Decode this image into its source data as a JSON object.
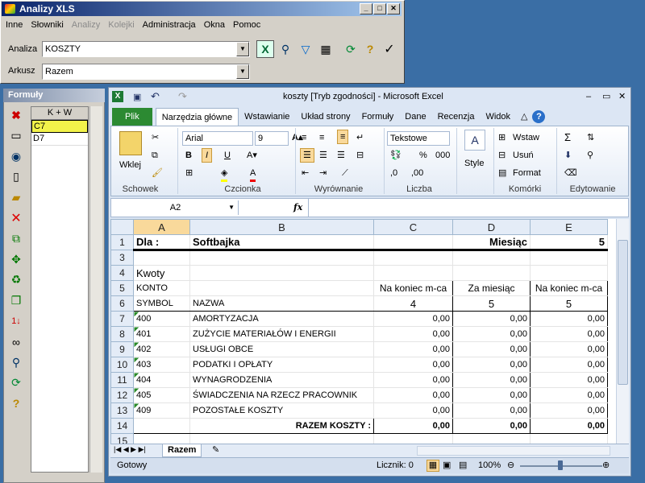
{
  "app": {
    "title": "Analizy XLS",
    "menu": [
      "Inne",
      "Słowniki",
      "Analizy",
      "Kolejki",
      "Administracja",
      "Okna",
      "Pomoc"
    ],
    "menu_disabled": [
      false,
      false,
      true,
      true,
      false,
      false,
      false
    ],
    "analiza_label": "Analiza",
    "analiza_value": "KOSZTY",
    "arkusz_label": "Arkusz",
    "arkusz_value": "Razem"
  },
  "formula_panel": {
    "title": "Formuły",
    "column_header": "K + W",
    "rows": [
      "C7",
      "D7"
    ]
  },
  "excel": {
    "title": "koszty  [Tryb zgodności]  -  Microsoft Excel",
    "tabs": [
      "Plik",
      "Narzędzia główne",
      "Wstawianie",
      "Układ strony",
      "Formuły",
      "Dane",
      "Recenzja",
      "Widok"
    ],
    "groups": {
      "schowek": "Schowek",
      "czcionka": "Czcionka",
      "wyrownanie": "Wyrównanie",
      "liczba": "Liczba",
      "komorki": "Komórki",
      "edytowanie": "Edytowanie"
    },
    "paste_label": "Wklej",
    "font_name": "Arial",
    "font_size": "9",
    "number_format": "Tekstowe",
    "style_label": "Style",
    "insert_label": "Wstaw",
    "delete_label": "Usuń",
    "format_label": "Format",
    "name_box": "A2",
    "fx": "fx",
    "columns": [
      "A",
      "B",
      "C",
      "D",
      "E"
    ],
    "rows": [
      {
        "n": "1",
        "a": "Dla :",
        "b": "Softbajka",
        "c": "",
        "d": "Miesiąc",
        "e": "5"
      },
      {
        "n": "3",
        "a": "",
        "b": "",
        "c": "",
        "d": "",
        "e": ""
      },
      {
        "n": "4",
        "a": "Kwoty",
        "b": "",
        "c": "",
        "d": "",
        "e": ""
      },
      {
        "n": "5",
        "a": "KONTO",
        "b": "",
        "c": "Na koniec m-ca",
        "d": "Za miesiąc",
        "e": "Na koniec m-ca"
      },
      {
        "n": "6",
        "a": "SYMBOL",
        "b": "NAZWA",
        "c": "4",
        "d": "5",
        "e": "5"
      },
      {
        "n": "7",
        "a": "400",
        "b": "AMORTYZACJA",
        "c": "0,00",
        "d": "0,00",
        "e": "0,00"
      },
      {
        "n": "8",
        "a": "401",
        "b": "ZUŻYCIE MATERIAŁÓW I ENERGII",
        "c": "0,00",
        "d": "0,00",
        "e": "0,00"
      },
      {
        "n": "9",
        "a": "402",
        "b": "USŁUGI OBCE",
        "c": "0,00",
        "d": "0,00",
        "e": "0,00"
      },
      {
        "n": "10",
        "a": "403",
        "b": "PODATKI I OPŁATY",
        "c": "0,00",
        "d": "0,00",
        "e": "0,00"
      },
      {
        "n": "11",
        "a": "404",
        "b": "WYNAGRODZENIA",
        "c": "0,00",
        "d": "0,00",
        "e": "0,00"
      },
      {
        "n": "12",
        "a": "405",
        "b": "ŚWIADCZENIA NA RZECZ PRACOWNIK",
        "c": "0,00",
        "d": "0,00",
        "e": "0,00"
      },
      {
        "n": "13",
        "a": "409",
        "b": "POZOSTAŁE KOSZTY",
        "c": "0,00",
        "d": "0,00",
        "e": "0,00"
      },
      {
        "n": "14",
        "a": "",
        "b": "RAZEM KOSZTY :",
        "c": "0,00",
        "d": "0,00",
        "e": "0,00"
      },
      {
        "n": "15",
        "a": "",
        "b": "",
        "c": "",
        "d": "",
        "e": ""
      }
    ],
    "sheet_tab": "Razem",
    "status_ready": "Gotowy",
    "status_count": "Licznik: 0",
    "zoom": "100%"
  }
}
